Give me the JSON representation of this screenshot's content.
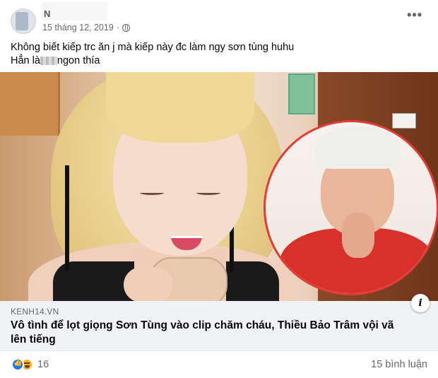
{
  "header": {
    "name_fragment": "N",
    "timestamp": "15 tháng 12, 2019",
    "more_label": "•••"
  },
  "post_text": {
    "line1": "Không biết kiếp trc ăn j mà kiếp này đc làm ngy sơn tùng huhu",
    "line2_before": "Hẳn là",
    "line2_after": "ngon thía"
  },
  "link_preview": {
    "domain": "KENH14.VN",
    "headline": "Vô tình để lọt giọng Sơn Tùng vào clip chăm cháu, Thiều Bảo Trâm vội vã lên tiếng",
    "info_label": "i"
  },
  "footer": {
    "reaction_icons": [
      "like-icon",
      "haha-icon"
    ],
    "reaction_count": "16",
    "comments": "15 bình luận"
  },
  "colors": {
    "link_bg": "#f0f2f5",
    "secondary_text": "#65676b",
    "like_blue": "#1877f2",
    "inset_border": "#e33b35"
  }
}
